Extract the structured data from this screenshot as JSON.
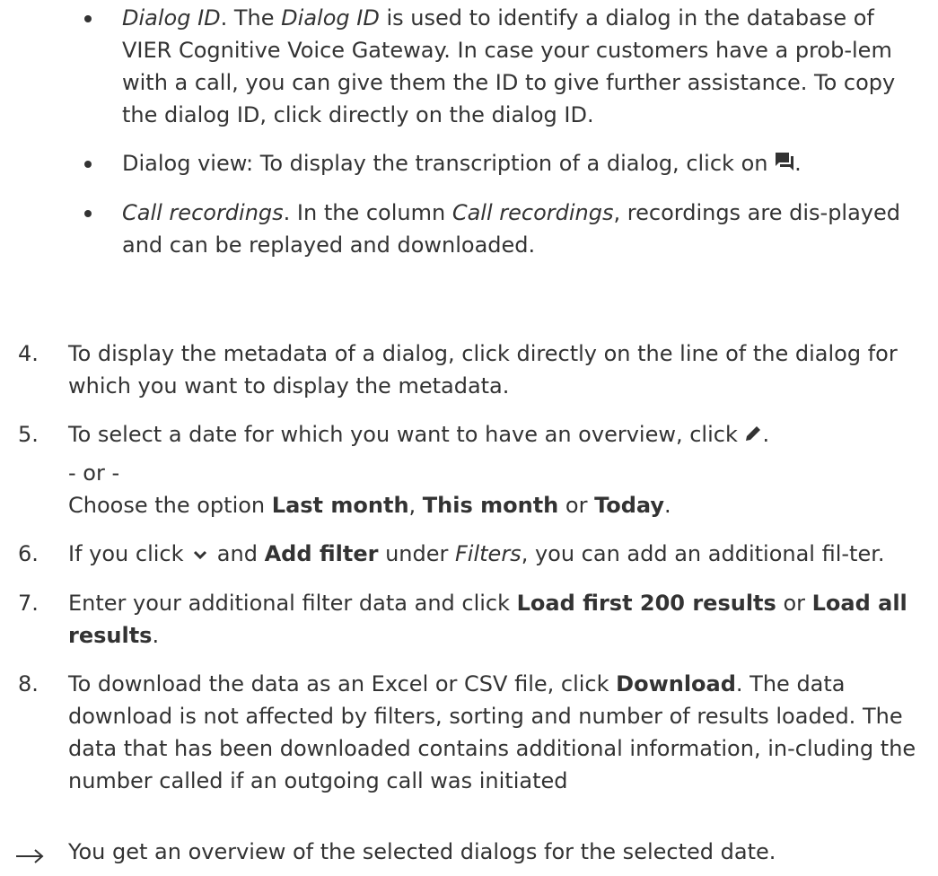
{
  "bullets": [
    {
      "p1": "Dialog ID",
      "p2": ". The ",
      "p3": "Dialog ID",
      "p4": " is used to identify a dialog in the database of VIER Cognitive Voice Gateway. In case your customers have a prob-lem with a call, you can give them the ID to give further assistance. To copy the dialog ID, click directly on the dialog ID."
    },
    {
      "p1": "Dialog view: To display the transcription of a dialog, click on ",
      "icon": "chat-bubble-icon",
      "p2": "."
    },
    {
      "p1": "Call recordings",
      "p2": ". In the column ",
      "p3": "Call recordings",
      "p4": ", recordings are dis-played and can be replayed and downloaded."
    }
  ],
  "steps": [
    {
      "num": "4.",
      "text": "To display the metadata of a dialog, click directly on the line of the dialog for which you want to display the metadata."
    },
    {
      "num": "5.",
      "p1": "To select a date for which you want to have an overview, click ",
      "icon": "pencil-icon",
      "p2": ".",
      "or": "- or -",
      "c1": "Choose the option ",
      "b1": "Last month",
      "c2": ", ",
      "b2": "This month",
      "c3": " or ",
      "b3": "Today",
      "c4": "."
    },
    {
      "num": "6.",
      "p1": "If you click ",
      "icon": "chevron-down-icon",
      "p2": " and ",
      "b1": "Add filter",
      "p3": " under ",
      "i1": "Filters",
      "p4": ", you can add an additional fil-ter."
    },
    {
      "num": "7.",
      "p1": "Enter your additional filter data and click ",
      "b1": "Load first 200 results",
      "p2": " or ",
      "b2": "Load all results",
      "p3": "."
    },
    {
      "num": "8.",
      "p1": "To download the data as an Excel or CSV file, click ",
      "b1": "Download",
      "p2": ". The data download is not affected by filters, sorting and number of results loaded. The data that has been downloaded contains additional information, in-cluding the number called if an outgoing call was initiated"
    }
  ],
  "result": {
    "icon": "result-arrow-icon",
    "text": "You get an overview of the selected dialogs for the selected date."
  }
}
